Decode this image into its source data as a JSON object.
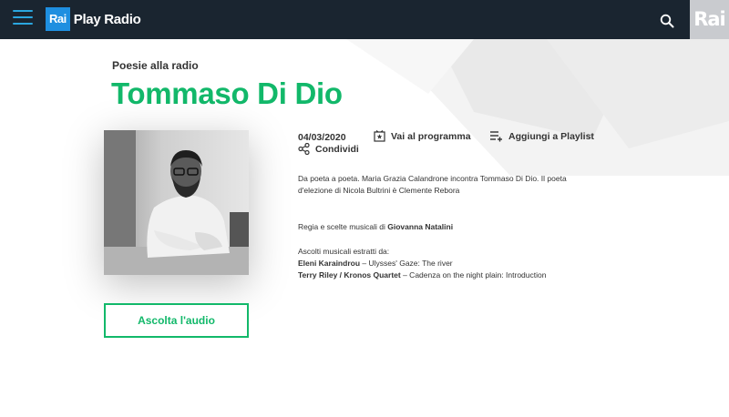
{
  "header": {
    "logo_badge": "Rai",
    "logo_text": "Play Radio",
    "corner_logo": "Rai",
    "menu_icon": "hamburger-menu-icon",
    "search_icon": "search-icon",
    "colors": {
      "bar": "#1a2530",
      "accent": "#2aa7e0",
      "logo_box": "#1e8fe0"
    }
  },
  "page": {
    "kicker": "Poesie alla radio",
    "title": "Tommaso Di Dio",
    "title_color": "#12b86a"
  },
  "meta": {
    "date": "04/03/2020",
    "vai_programma": "Vai al programma",
    "aggiungi_playlist": "Aggiungi a Playlist",
    "condividi": "Condividi"
  },
  "description": {
    "p1": "Da poeta a poeta. Maria Grazia Calandrone incontra Tommaso Di Dio. Il poeta d'elezione di Nicola Bultrini è Clemente Rebora",
    "regia_prefix": "Regia e scelte musicali di ",
    "regia_name": "Giovanna Natalini",
    "ascolti_intro": "Ascolti musicali estratti da:",
    "track1_artist": "Eleni Karaindrou",
    "track1_title": " – Ulysses' Gaze: The river",
    "track2_artist": "Terry Riley / Kronos Quartet",
    "track2_title": " – Cadenza on the night plain: Introduction"
  },
  "cta": {
    "listen_label": "Ascolta l'audio"
  }
}
